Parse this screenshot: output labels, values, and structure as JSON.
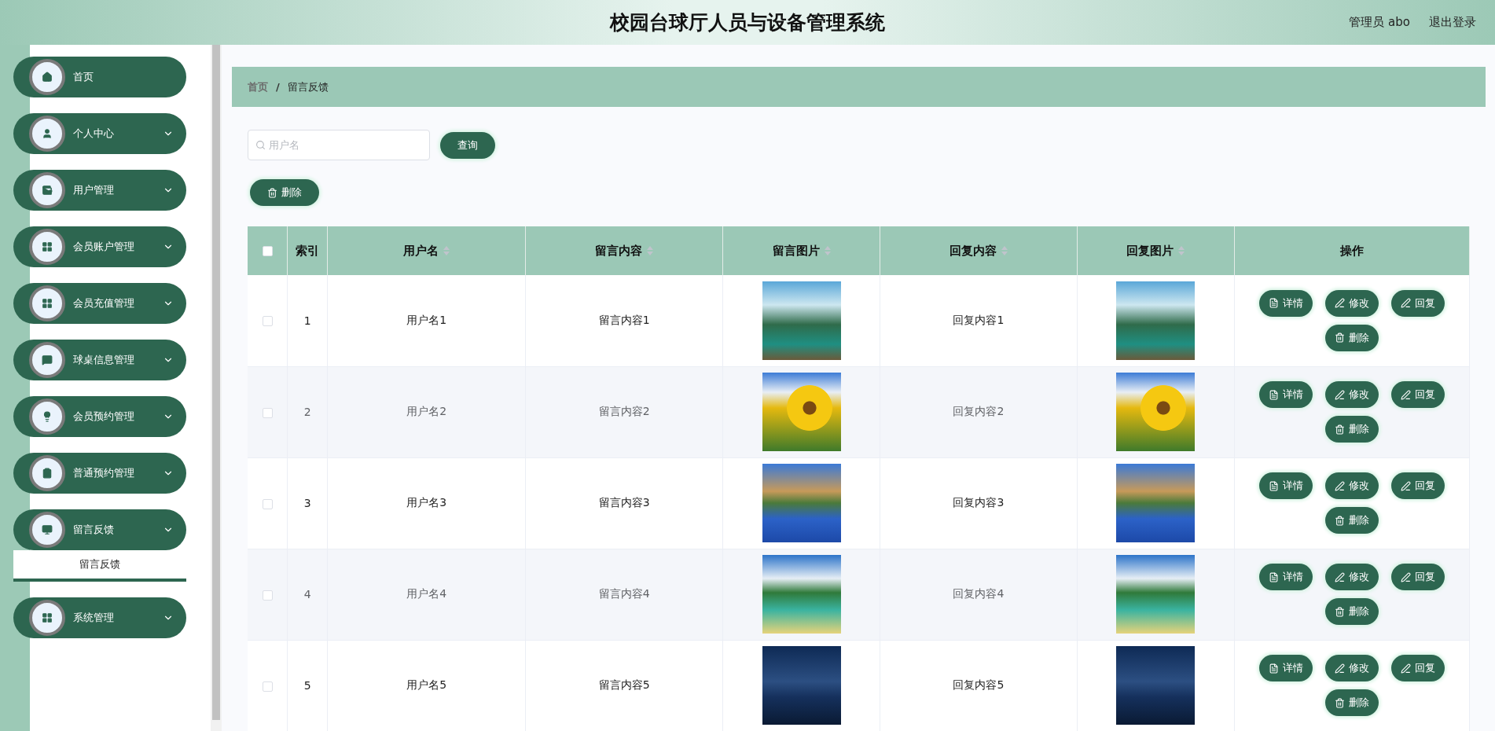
{
  "header": {
    "title": "校园台球厅人员与设备管理系统",
    "user": "管理员 abo",
    "logout": "退出登录"
  },
  "sidebar": {
    "items": [
      {
        "label": "首页",
        "has_arrow": false
      },
      {
        "label": "个人中心",
        "has_arrow": true
      },
      {
        "label": "用户管理",
        "has_arrow": true
      },
      {
        "label": "会员账户管理",
        "has_arrow": true
      },
      {
        "label": "会员充值管理",
        "has_arrow": true
      },
      {
        "label": "球桌信息管理",
        "has_arrow": true
      },
      {
        "label": "会员预约管理",
        "has_arrow": true
      },
      {
        "label": "普通预约管理",
        "has_arrow": true
      },
      {
        "label": "留言反馈",
        "expanded": true,
        "has_arrow": true,
        "children": [
          {
            "label": "留言反馈",
            "selected": true
          }
        ]
      },
      {
        "label": "系统管理",
        "has_arrow": true
      }
    ]
  },
  "breadcrumb": {
    "separator": "/",
    "items": [
      {
        "label": "首页",
        "current": false
      },
      {
        "label": "留言反馈",
        "current": true
      }
    ]
  },
  "search": {
    "placeholder": "用户名",
    "button": "查询"
  },
  "delete_button": "删除",
  "table": {
    "select_all_checked": false,
    "columns": [
      {
        "kind": "index",
        "label": "索引",
        "sortable": false
      },
      {
        "kind": "username",
        "label": "用户名",
        "sortable": true
      },
      {
        "kind": "message",
        "label": "留言内容",
        "sortable": true
      },
      {
        "kind": "message_image",
        "label": "留言图片",
        "sortable": true
      },
      {
        "kind": "reply",
        "label": "回复内容",
        "sortable": true
      },
      {
        "kind": "reply_image",
        "label": "回复图片",
        "sortable": true
      },
      {
        "kind": "actions",
        "label": "操作",
        "sortable": false
      }
    ],
    "rows": [
      {
        "checked": false,
        "index": "1",
        "username": "用户名1",
        "message": "留言内容1",
        "reply": "回复内容1",
        "actions": [
          {
            "kind": "detail",
            "label": "详情"
          },
          {
            "kind": "edit",
            "label": "修改"
          },
          {
            "kind": "edit",
            "label": "回复"
          },
          {
            "kind": "delete",
            "label": "删除"
          }
        ]
      },
      {
        "checked": false,
        "index": "2",
        "username": "用户名2",
        "message": "留言内容2",
        "reply": "回复内容2",
        "actions": [
          {
            "kind": "detail",
            "label": "详情"
          },
          {
            "kind": "edit",
            "label": "修改"
          },
          {
            "kind": "edit",
            "label": "回复"
          },
          {
            "kind": "delete",
            "label": "删除"
          }
        ]
      },
      {
        "checked": false,
        "index": "3",
        "username": "用户名3",
        "message": "留言内容3",
        "reply": "回复内容3",
        "actions": [
          {
            "kind": "detail",
            "label": "详情"
          },
          {
            "kind": "edit",
            "label": "修改"
          },
          {
            "kind": "edit",
            "label": "回复"
          },
          {
            "kind": "delete",
            "label": "删除"
          }
        ]
      },
      {
        "checked": false,
        "index": "4",
        "username": "用户名4",
        "message": "留言内容4",
        "reply": "回复内容4",
        "actions": [
          {
            "kind": "detail",
            "label": "详情"
          },
          {
            "kind": "edit",
            "label": "修改"
          },
          {
            "kind": "edit",
            "label": "回复"
          },
          {
            "kind": "delete",
            "label": "删除"
          }
        ]
      },
      {
        "checked": false,
        "index": "5",
        "username": "用户名5",
        "message": "留言内容5",
        "reply": "回复内容5",
        "actions": [
          {
            "kind": "detail",
            "label": "详情"
          },
          {
            "kind": "edit",
            "label": "修改"
          },
          {
            "kind": "edit",
            "label": "回复"
          },
          {
            "kind": "delete",
            "label": "删除"
          }
        ]
      }
    ]
  }
}
